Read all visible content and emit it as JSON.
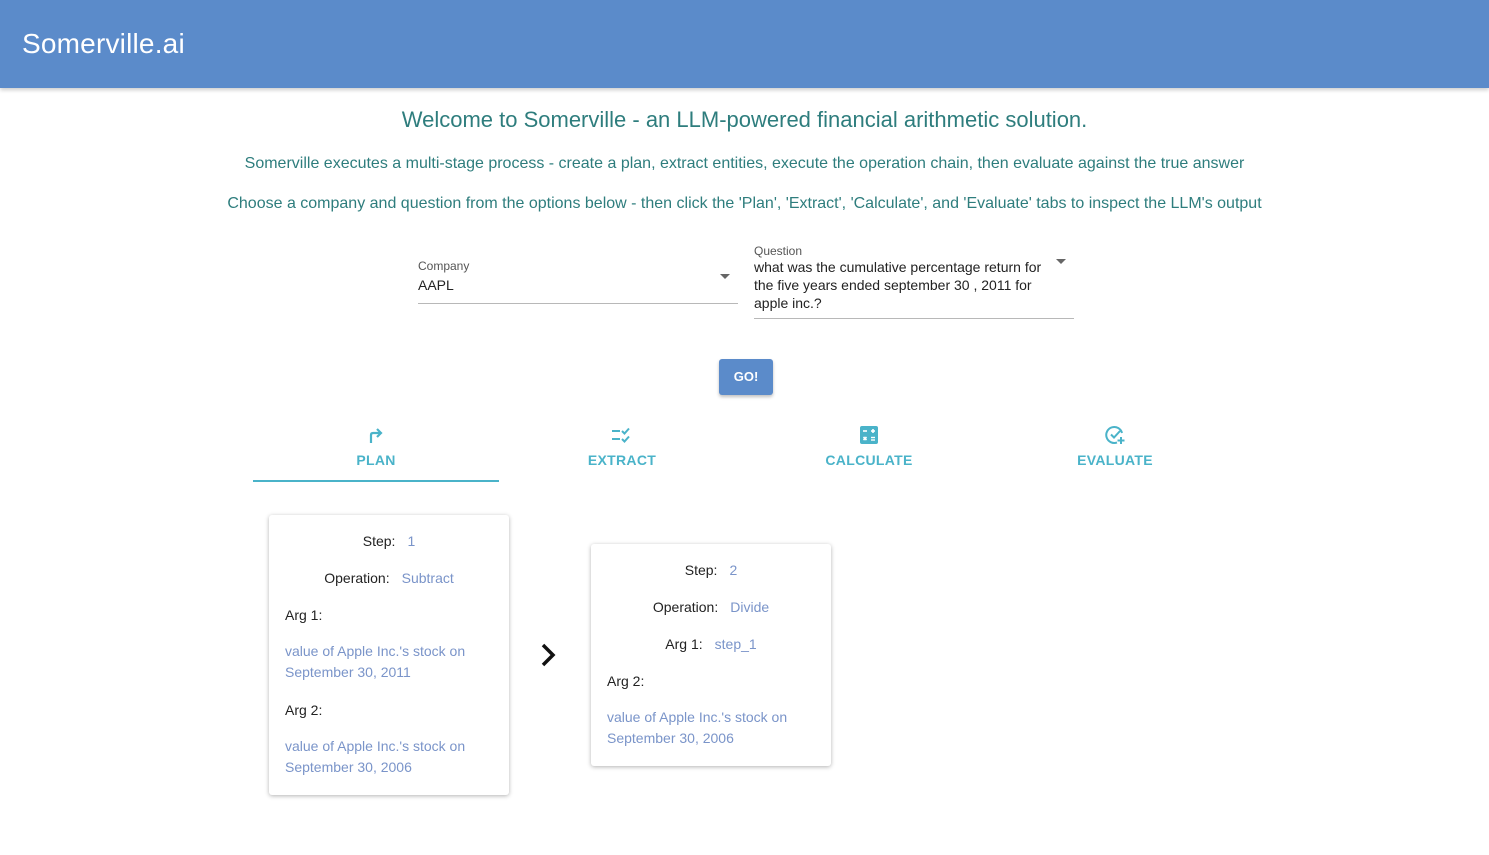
{
  "app": {
    "title": "Somerville.ai"
  },
  "intro": {
    "heading": "Welcome to Somerville - an LLM-powered financial arithmetic solution.",
    "line1": "Somerville executes a multi-stage process - create a plan, extract entities, execute the operation chain, then evaluate against the true answer",
    "line2": "Choose a company and question from the options below - then click the 'Plan', 'Extract', 'Calculate', and 'Evaluate' tabs to inspect the LLM's output"
  },
  "form": {
    "company": {
      "label": "Company",
      "value": "AAPL"
    },
    "question": {
      "label": "Question",
      "value": "what was the cumulative percentage return for the five years ended september 30 , 2011 for apple inc.?"
    },
    "go_label": "GO!"
  },
  "tabs": [
    {
      "label": "PLAN",
      "icon": "route-icon",
      "active": true
    },
    {
      "label": "EXTRACT",
      "icon": "checklist-icon",
      "active": false
    },
    {
      "label": "CALCULATE",
      "icon": "calculator-icon",
      "active": false
    },
    {
      "label": "EVALUATE",
      "icon": "check-circle-add-icon",
      "active": false
    }
  ],
  "plan": {
    "labels": {
      "step": "Step:",
      "operation": "Operation:",
      "arg1": "Arg 1:",
      "arg2": "Arg 2:"
    },
    "steps": [
      {
        "step": "1",
        "operation": "Subtract",
        "arg1": "value of Apple Inc.'s stock on September 30, 2011",
        "arg2": "value of Apple Inc.'s stock on September 30, 2006"
      },
      {
        "step": "2",
        "operation": "Divide",
        "arg1": "step_1",
        "arg2": "value of Apple Inc.'s stock on September 30, 2006"
      }
    ]
  },
  "colors": {
    "appbar": "#5b8bca",
    "accent": "#4ab3c9",
    "heading_text": "#2e7d7d",
    "value_text": "#7a94c9"
  }
}
